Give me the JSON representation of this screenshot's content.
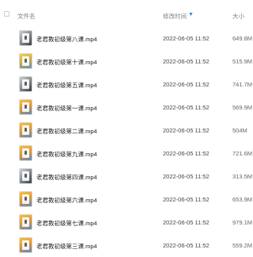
{
  "header": {
    "name_label": "文件名",
    "time_label": "修改时间",
    "size_label": "大小"
  },
  "files": [
    {
      "name": "老君教初级第八课.mp4",
      "time": "2022-06-05 11:52",
      "size": "649.8M",
      "thumb": "dark"
    },
    {
      "name": "老君教初级第十课.mp4",
      "time": "2022-06-05 11:52",
      "size": "515.9M",
      "thumb": "yellow"
    },
    {
      "name": "老君教初级第五课.mp4",
      "time": "2022-06-05 11:52",
      "size": "741.7M",
      "thumb": "dark"
    },
    {
      "name": "老君教初级第一课.mp4",
      "time": "2022-06-05 11:52",
      "size": "569.9M",
      "thumb": "orange"
    },
    {
      "name": "老君教初级第二课.mp4",
      "time": "2022-06-05 11:52",
      "size": "504M",
      "thumb": "orange"
    },
    {
      "name": "老君教初级第九课.mp4",
      "time": "2022-06-05 11:52",
      "size": "721.6M",
      "thumb": "orange"
    },
    {
      "name": "老君教初级第四课.mp4",
      "time": "2022-06-05 11:52",
      "size": "313.5M",
      "thumb": "dark"
    },
    {
      "name": "老君教初级第六课.mp4",
      "time": "2022-06-05 11:52",
      "size": "653.9M",
      "thumb": "orange"
    },
    {
      "name": "老君教初级第七课.mp4",
      "time": "2022-06-05 11:52",
      "size": "979.1M",
      "thumb": "orange"
    },
    {
      "name": "老君教初级第三课.mp4",
      "time": "2022-06-05 11:52",
      "size": "559.2M",
      "thumb": "orange"
    }
  ]
}
